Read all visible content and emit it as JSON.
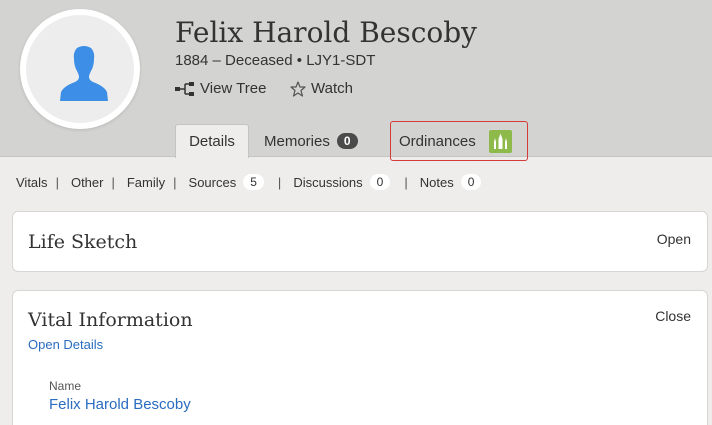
{
  "person": {
    "name": "Felix Harold Bescoby",
    "lifespan": "1884 – Deceased",
    "separator": "•",
    "pid": "LJY1-SDT"
  },
  "actions": {
    "view_tree": "View Tree",
    "watch": "Watch"
  },
  "tabs": {
    "details": "Details",
    "memories": "Memories",
    "memories_count": "0",
    "ordinances": "Ordinances"
  },
  "subnav": {
    "vitals": "Vitals",
    "other": "Other",
    "family": "Family",
    "sources": "Sources",
    "sources_count": "5",
    "discussions": "Discussions",
    "discussions_count": "0",
    "notes": "Notes",
    "notes_count": "0",
    "separator": "|"
  },
  "life_sketch": {
    "title": "Life Sketch",
    "toggle": "Open"
  },
  "vital_information": {
    "title": "Vital Information",
    "toggle": "Close",
    "open_details": "Open Details",
    "name_label": "Name",
    "name_value": "Felix Harold Bescoby"
  },
  "colors": {
    "header_bg": "#d3d3d1",
    "page_bg": "#eeedeb",
    "link_blue": "#2a6cc0",
    "temple_green": "#8dba4a",
    "highlight_red": "#d33a3a",
    "avatar_blue": "#3d8ee6"
  },
  "icons": {
    "avatar": "person-silhouette",
    "tree": "tree-icon",
    "watch": "star-outline-icon",
    "temple": "temple-icon"
  }
}
